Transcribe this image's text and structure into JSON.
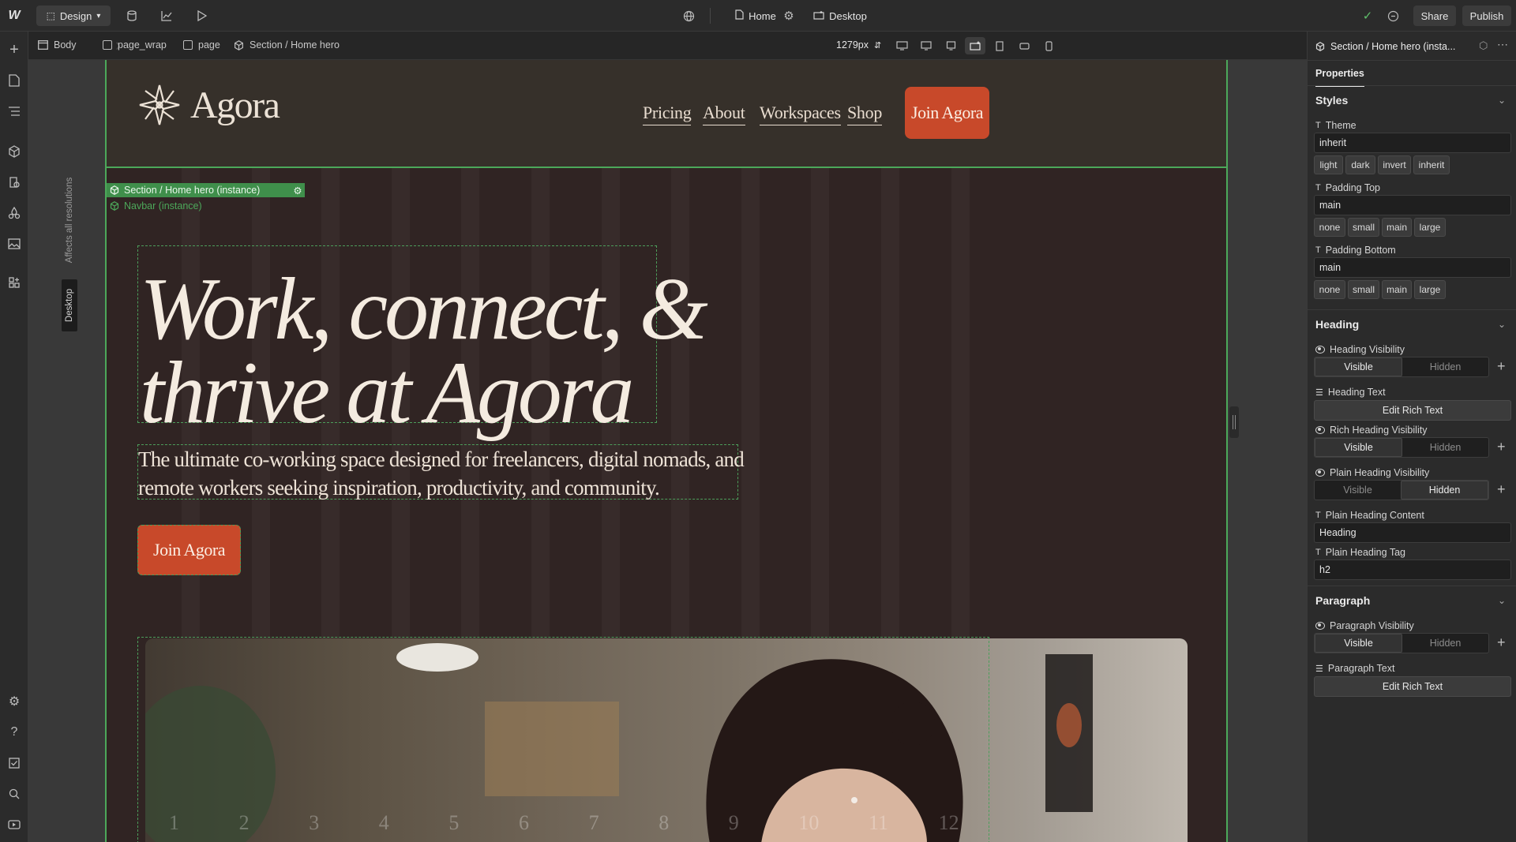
{
  "topbar": {
    "mode_label": "Design",
    "page_name": "Home",
    "breakpoint_name": "Desktop",
    "share_label": "Share",
    "publish_label": "Publish"
  },
  "breadcrumbs": [
    "Body",
    "page_wrap",
    "page",
    "Section / Home hero"
  ],
  "canvas_width_readout": "1279px",
  "side_labels": {
    "affects": "Affects all resolutions",
    "desktop": "Desktop"
  },
  "site": {
    "logo_text": "Agora",
    "nav": [
      "Pricing",
      "About",
      "Workspaces",
      "Shop"
    ],
    "nav_cta": "Join Agora",
    "hero_title_line1": "Work, connect, &",
    "hero_title_line2": "thrive at Agora",
    "hero_subtitle_line1": "The ultimate co-working space designed for freelancers, digital nomads, and",
    "hero_subtitle_line2": "remote workers seeking inspiration, productivity, and community.",
    "hero_cta": "Join Agora",
    "column_numbers": [
      "1",
      "2",
      "3",
      "4",
      "5",
      "6",
      "7",
      "8",
      "9",
      "10",
      "11",
      "12"
    ]
  },
  "selection": {
    "section_tag": "Section / Home hero (instance)",
    "navbar_tag": "Navbar (instance)"
  },
  "panel": {
    "title": "Section / Home hero (insta...",
    "tab": "Properties",
    "styles": {
      "heading": "Styles",
      "theme_label": "Theme",
      "theme_value": "inherit",
      "theme_options": [
        "light",
        "dark",
        "invert",
        "inherit"
      ],
      "padding_top_label": "Padding Top",
      "padding_top_value": "main",
      "padding_options": [
        "none",
        "small",
        "main",
        "large"
      ],
      "padding_bottom_label": "Padding Bottom",
      "padding_bottom_value": "main"
    },
    "heading_section": {
      "heading": "Heading",
      "visibility_label": "Heading Visibility",
      "visible": "Visible",
      "hidden": "Hidden",
      "text_label": "Heading Text",
      "edit_rich_text": "Edit Rich Text",
      "rich_visibility_label": "Rich Heading Visibility",
      "plain_visibility_label": "Plain Heading Visibility",
      "plain_content_label": "Plain Heading Content",
      "plain_content_value": "Heading",
      "plain_tag_label": "Plain Heading Tag",
      "plain_tag_value": "h2"
    },
    "paragraph_section": {
      "heading": "Paragraph",
      "visibility_label": "Paragraph Visibility",
      "text_label": "Paragraph Text",
      "edit_rich_text": "Edit Rich Text"
    }
  },
  "colors": {
    "accent_green": "#4ca85a",
    "brand_orange": "#c8492a",
    "page_bg": "#302423"
  }
}
